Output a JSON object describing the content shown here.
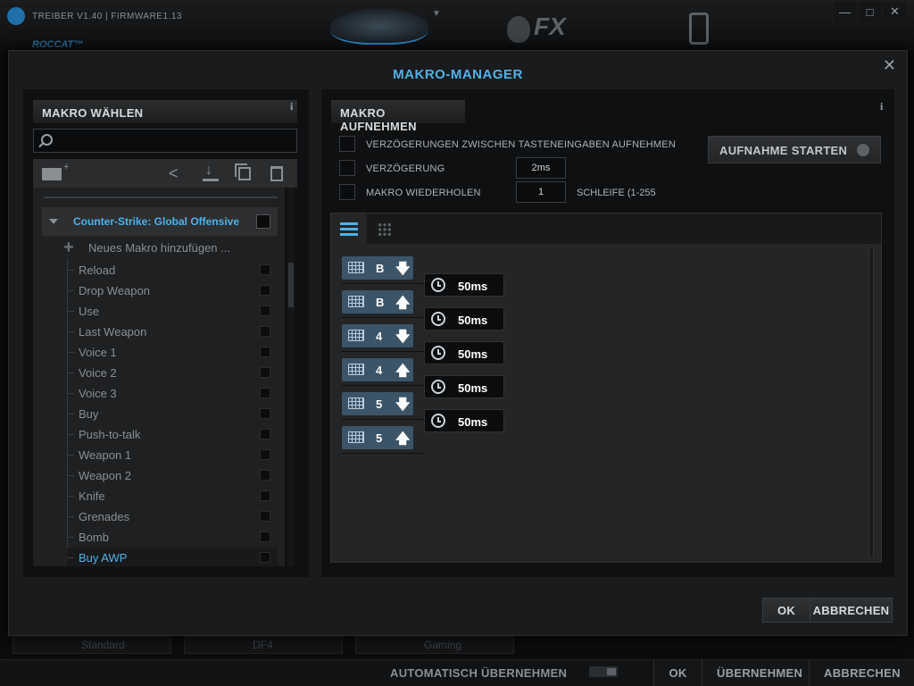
{
  "app": {
    "title": "TREIBER V1.40 | FIRMWARE1.13",
    "brand": "ROCCAT™",
    "fx_logo": "FX",
    "window_controls": [
      "—",
      "□",
      "✕"
    ],
    "profiles": [
      "Standard",
      "DF4",
      "Gaming"
    ],
    "auto_apply_label": "AUTOMATISCH ÜBERNEHMEN",
    "bottom_buttons": {
      "ok": "OK",
      "apply": "ÜBERNEHMEN",
      "cancel": "ABBRECHEN"
    }
  },
  "modal": {
    "title": "MAKRO-MANAGER",
    "close": "✕",
    "left": {
      "header": "MAKRO WÄHLEN",
      "info": "i",
      "search_placeholder": "",
      "game": "Counter-Strike: Global Offensive",
      "add_macro": "Neues Makro hinzufügen ...",
      "macros": [
        "Reload",
        "Drop Weapon",
        "Use",
        "Last Weapon",
        "Voice 1",
        "Voice 2",
        "Voice 3",
        "Buy",
        "Push-to-talk",
        "Weapon 1",
        "Weapon 2",
        "Knife",
        "Grenades",
        "Bomb",
        "Buy AWP"
      ],
      "selected_macro": "Buy AWP"
    },
    "right": {
      "header": "MAKRO AUFNEHMEN",
      "info": "i",
      "opt_record_delays": "VERZÖGERUNGEN ZWISCHEN TASTENEINGABEN AUFNEHMEN",
      "opt_delay": "VERZÖGERUNG",
      "delay_value": "2ms",
      "opt_repeat": "MAKRO WIEDERHOLEN",
      "repeat_value": "1",
      "repeat_suffix": "SCHLEIFE (1-255",
      "record_button": "AUFNAHME STARTEN",
      "sequence": [
        {
          "key": "B",
          "dir": "down",
          "arrow": "🡇"
        },
        {
          "key": "B",
          "dir": "up",
          "arrow": "🡅"
        },
        {
          "key": "4",
          "dir": "down",
          "arrow": "🡇"
        },
        {
          "key": "4",
          "dir": "up",
          "arrow": "🡅"
        },
        {
          "key": "5",
          "dir": "down",
          "arrow": "🡇"
        },
        {
          "key": "5",
          "dir": "up",
          "arrow": "🡅"
        }
      ],
      "delays": [
        "50ms",
        "50ms",
        "50ms",
        "50ms",
        "50ms"
      ]
    },
    "buttons": {
      "ok": "OK",
      "cancel": "ABBRECHEN"
    }
  },
  "colors": {
    "accent": "#4fb2ea",
    "key_block": "#3b5468",
    "panel": "#0f1011"
  }
}
